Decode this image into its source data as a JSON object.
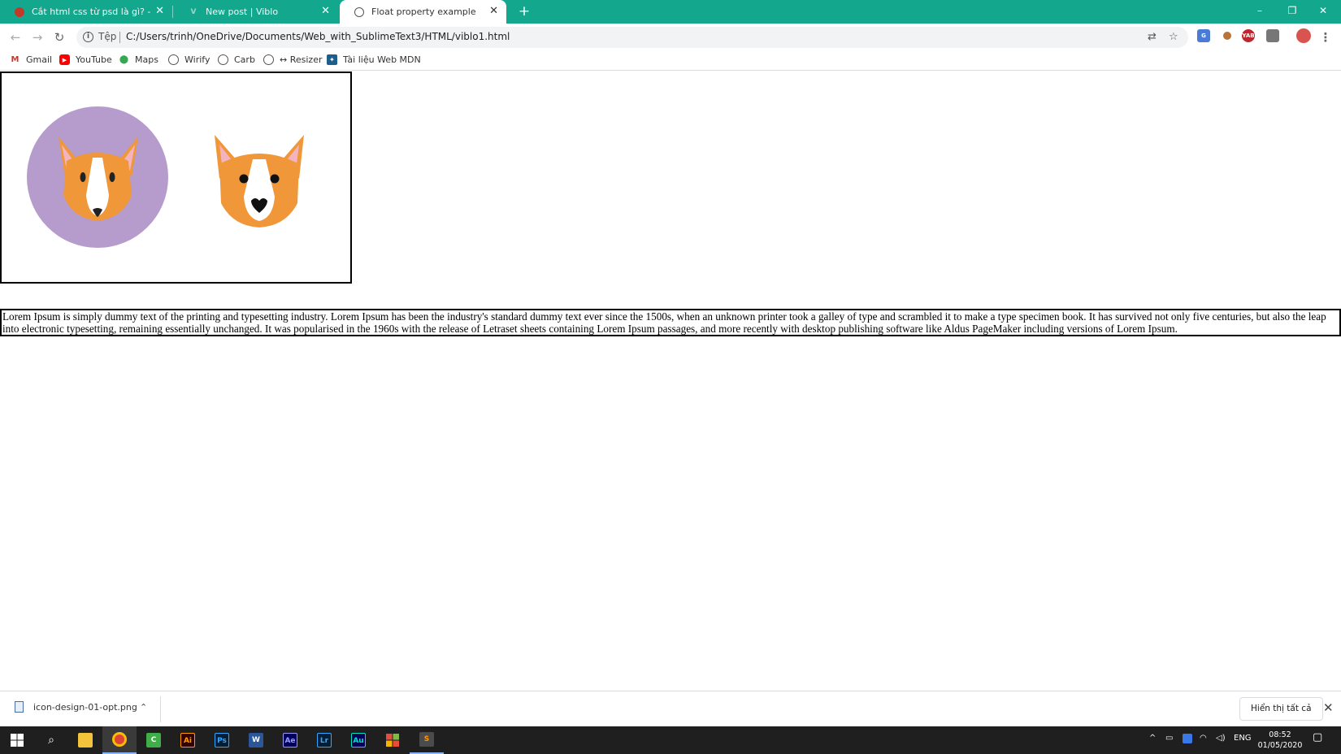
{
  "browser": {
    "tabs": [
      {
        "title": "Cắt html css từ psd là gì? - Học lậ",
        "active": false
      },
      {
        "title": "New post | Viblo",
        "active": false
      },
      {
        "title": "Float property example",
        "active": true
      }
    ],
    "new_tab_label": "+",
    "window_controls": {
      "minimize": "–",
      "maximize": "❐",
      "close": "✕"
    },
    "nav": {
      "back": "←",
      "forward": "→",
      "reload": "↻"
    },
    "address": {
      "scheme_label": "Tệp",
      "url": "C:/Users/trinh/OneDrive/Documents/Web_with_SublimeText3/HTML/viblo1.html"
    },
    "bookmarks": [
      {
        "label": "Gmail",
        "icon": "gmail-icon"
      },
      {
        "label": "YouTube",
        "icon": "youtube-icon"
      },
      {
        "label": "Maps",
        "icon": "maps-icon"
      },
      {
        "label": "Wirify",
        "icon": "globe-icon"
      },
      {
        "label": "Carb",
        "icon": "globe-icon"
      },
      {
        "label": "↔ Resizer",
        "icon": "globe-icon"
      },
      {
        "label": "Tài liệu Web MDN",
        "icon": "mdn-icon"
      }
    ]
  },
  "page": {
    "images": [
      {
        "alt": "corgi icon with purple circle background",
        "icon": "corgi-circle-icon"
      },
      {
        "alt": "corgi icon",
        "icon": "corgi-icon"
      }
    ],
    "paragraph": "Lorem Ipsum is simply dummy text of the printing and typesetting industry. Lorem Ipsum has been the industry's standard dummy text ever since the 1500s, when an unknown printer took a galley of type and scrambled it to make a type specimen book. It has survived not only five centuries, but also the leap into electronic typesetting, remaining essentially unchanged. It was popularised in the 1960s with the release of Letraset sheets containing Lorem Ipsum passages, and more recently with desktop publishing software like Aldus PageMaker including versions of Lorem Ipsum."
  },
  "downloads": {
    "file_name": "icon-design-01-opt.png",
    "show_all_label": "Hiển thị tất cả"
  },
  "taskbar": {
    "apps": [
      {
        "name": "file-explorer",
        "glyph": "",
        "color": "#f3c33c"
      },
      {
        "name": "chrome",
        "glyph": "",
        "color": "#db4437"
      },
      {
        "name": "camtasia",
        "glyph": "C",
        "color": "#3fae49"
      },
      {
        "name": "illustrator",
        "glyph": "Ai",
        "color": "#ff9a00"
      },
      {
        "name": "photoshop",
        "glyph": "Ps",
        "color": "#31a8ff"
      },
      {
        "name": "word",
        "glyph": "W",
        "color": "#2b579a"
      },
      {
        "name": "after-effects",
        "glyph": "Ae",
        "color": "#9999ff"
      },
      {
        "name": "lightroom",
        "glyph": "Lr",
        "color": "#31a8ff"
      },
      {
        "name": "audition",
        "glyph": "Au",
        "color": "#00e4bb"
      },
      {
        "name": "office",
        "glyph": "",
        "color": "#e74c3c"
      },
      {
        "name": "sublime-text",
        "glyph": "S",
        "color": "#ff9800"
      }
    ],
    "language": "ENG",
    "time": "08:52",
    "date": "01/05/2020"
  },
  "colors": {
    "tab_bar": "#13a88e",
    "corgi_orange": "#f0973a",
    "corgi_ear_inner": "#f3b4bf",
    "circle_purple": "#b59ccd"
  }
}
